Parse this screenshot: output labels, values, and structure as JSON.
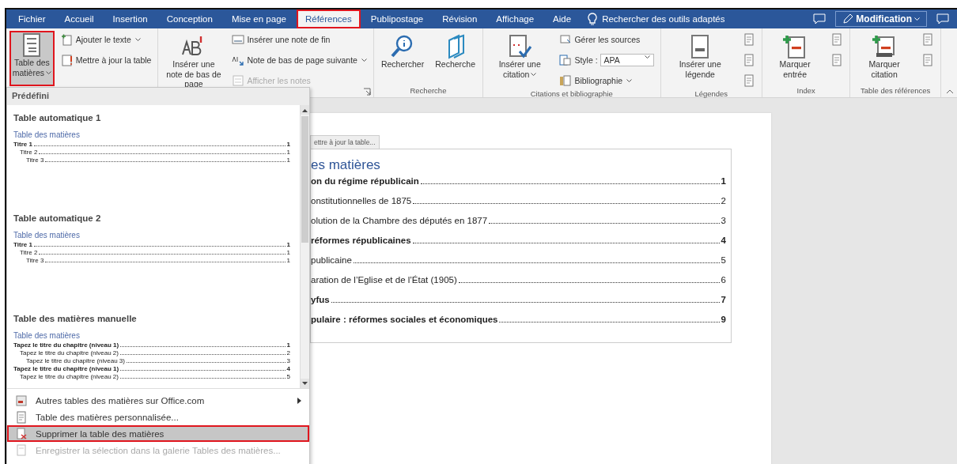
{
  "tabs": [
    {
      "label": "Fichier",
      "selected": false,
      "highlighted": false
    },
    {
      "label": "Accueil",
      "selected": false,
      "highlighted": false
    },
    {
      "label": "Insertion",
      "selected": false,
      "highlighted": false
    },
    {
      "label": "Conception",
      "selected": false,
      "highlighted": false
    },
    {
      "label": "Mise en page",
      "selected": false,
      "highlighted": false
    },
    {
      "label": "Références",
      "selected": true,
      "highlighted": true
    },
    {
      "label": "Publipostage",
      "selected": false,
      "highlighted": false
    },
    {
      "label": "Révision",
      "selected": false,
      "highlighted": false
    },
    {
      "label": "Affichage",
      "selected": false,
      "highlighted": false
    },
    {
      "label": "Aide",
      "selected": false,
      "highlighted": false
    }
  ],
  "search": {
    "placeholder": "Rechercher des outils adaptés"
  },
  "mode_button": {
    "label": "Modification"
  },
  "ribbon_groups": [
    {
      "buttons": [
        {
          "kind": "large",
          "label": "Table des matières",
          "dropdown": true,
          "highlighted": true,
          "disabled": false
        },
        {
          "kind": "small",
          "label": "Ajouter le texte",
          "dropdown": true,
          "highlighted": false,
          "disabled": false
        },
        {
          "kind": "small",
          "label": "Mettre à jour la table",
          "dropdown": false,
          "highlighted": false,
          "disabled": false
        }
      ]
    },
    {
      "launcher": true,
      "buttons": [
        {
          "kind": "large",
          "label": "Insérer une note de bas de page",
          "dropdown": false,
          "highlighted": false,
          "disabled": false
        },
        {
          "kind": "small",
          "label": "Insérer une note de fin",
          "dropdown": false,
          "highlighted": false,
          "disabled": false
        },
        {
          "kind": "small",
          "label": "Note de bas de page suivante",
          "dropdown": true,
          "highlighted": false,
          "disabled": false
        },
        {
          "kind": "small",
          "label": "Afficher les notes",
          "dropdown": false,
          "highlighted": false,
          "disabled": true
        }
      ]
    },
    {
      "label": "Recherche",
      "buttons": [
        {
          "kind": "large",
          "label": "Rechercher",
          "dropdown": false,
          "highlighted": false,
          "disabled": false
        },
        {
          "kind": "large",
          "label": "Recherche",
          "dropdown": false,
          "highlighted": false,
          "disabled": false
        }
      ]
    },
    {
      "label": "Citations et bibliographie",
      "buttons": [
        {
          "kind": "large",
          "label": "Insérer une citation",
          "dropdown": true,
          "highlighted": false,
          "disabled": false
        },
        {
          "kind": "small",
          "label": "Gérer les sources",
          "dropdown": false,
          "highlighted": false,
          "disabled": false
        },
        {
          "kind": "select",
          "label": "Style :",
          "value": "APA",
          "dropdown": true,
          "highlighted": false,
          "disabled": false
        },
        {
          "kind": "small",
          "label": "Bibliographie",
          "dropdown": true,
          "highlighted": false,
          "disabled": false
        }
      ]
    },
    {
      "label": "Légendes",
      "buttons": [
        {
          "kind": "large",
          "label": "Insérer une légende",
          "dropdown": false,
          "highlighted": false,
          "disabled": false
        }
      ]
    },
    {
      "label": "Index",
      "buttons": [
        {
          "kind": "large",
          "label": "Marquer entrée",
          "dropdown": false,
          "highlighted": false,
          "disabled": false
        }
      ]
    },
    {
      "label": "Table des références",
      "buttons": [
        {
          "kind": "large",
          "label": "Marquer citation",
          "dropdown": false,
          "highlighted": false,
          "disabled": false
        }
      ]
    }
  ],
  "document": {
    "update_tab": "ettre à jour la table...",
    "toc_heading": "es matières",
    "entries": [
      {
        "text": "on du régime républicain",
        "page": "1",
        "children": [
          {
            "text": "onstitutionnelles de 1875",
            "page": "2"
          },
          {
            "text": "olution de la Chambre des députés en 1877",
            "page": "3"
          }
        ]
      },
      {
        "text": "réformes républicaines",
        "page": "4",
        "children": [
          {
            "text": "publicaine",
            "page": "5"
          },
          {
            "text": "aration de l’Eglise et de l’État (1905)",
            "page": "6"
          }
        ]
      },
      {
        "text": "yfus",
        "page": "7"
      },
      {
        "text": "pulaire : réformes sociales et économiques",
        "page": "9"
      }
    ]
  },
  "toc_menu": {
    "header": "Prédéfini",
    "gallery": [
      {
        "title": "Table automatique 1",
        "preview_heading": "Table des matières",
        "entries": [
          {
            "text": "Titre 1",
            "page": "1",
            "children": [
              {
                "text": "Titre 2",
                "page": "1",
                "children": [
                  {
                    "text": "Titre 3",
                    "page": "1"
                  }
                ]
              }
            ]
          }
        ]
      },
      {
        "title": "Table automatique 2",
        "preview_heading": "Table des matières",
        "entries": [
          {
            "text": "Titre 1",
            "page": "1",
            "children": [
              {
                "text": "Titre 2",
                "page": "1",
                "children": [
                  {
                    "text": "Titre 3",
                    "page": "1"
                  }
                ]
              }
            ]
          }
        ]
      },
      {
        "title": "Table des matières manuelle",
        "preview_heading": "Table des matières",
        "entries": [
          {
            "text": "Tapez le titre du chapitre (niveau 1)",
            "page": "1",
            "children": [
              {
                "text": "Tapez le titre du chapitre (niveau 2)",
                "page": "2",
                "children": [
                  {
                    "text": "Tapez le titre du chapitre (niveau 3)",
                    "page": "3"
                  }
                ]
              }
            ]
          },
          {
            "text": "Tapez le titre du chapitre (niveau 1)",
            "page": "4",
            "children": [
              {
                "text": "Tapez le titre du chapitre (niveau 2)",
                "page": "5"
              }
            ]
          }
        ]
      }
    ],
    "items": [
      {
        "kind": "office",
        "label": "Autres tables des matières sur Office.com",
        "submenu": true,
        "disabled": false,
        "highlighted": false
      },
      {
        "kind": "custom",
        "label": "Table des matières personnalisée...",
        "submenu": false,
        "disabled": false,
        "highlighted": false
      },
      {
        "kind": "remove",
        "label": "Supprimer la table des matières",
        "submenu": false,
        "disabled": false,
        "highlighted": true
      },
      {
        "kind": "save",
        "label": "Enregistrer la sélection dans la galerie Tables des matières...",
        "submenu": false,
        "disabled": true,
        "highlighted": false
      }
    ]
  }
}
